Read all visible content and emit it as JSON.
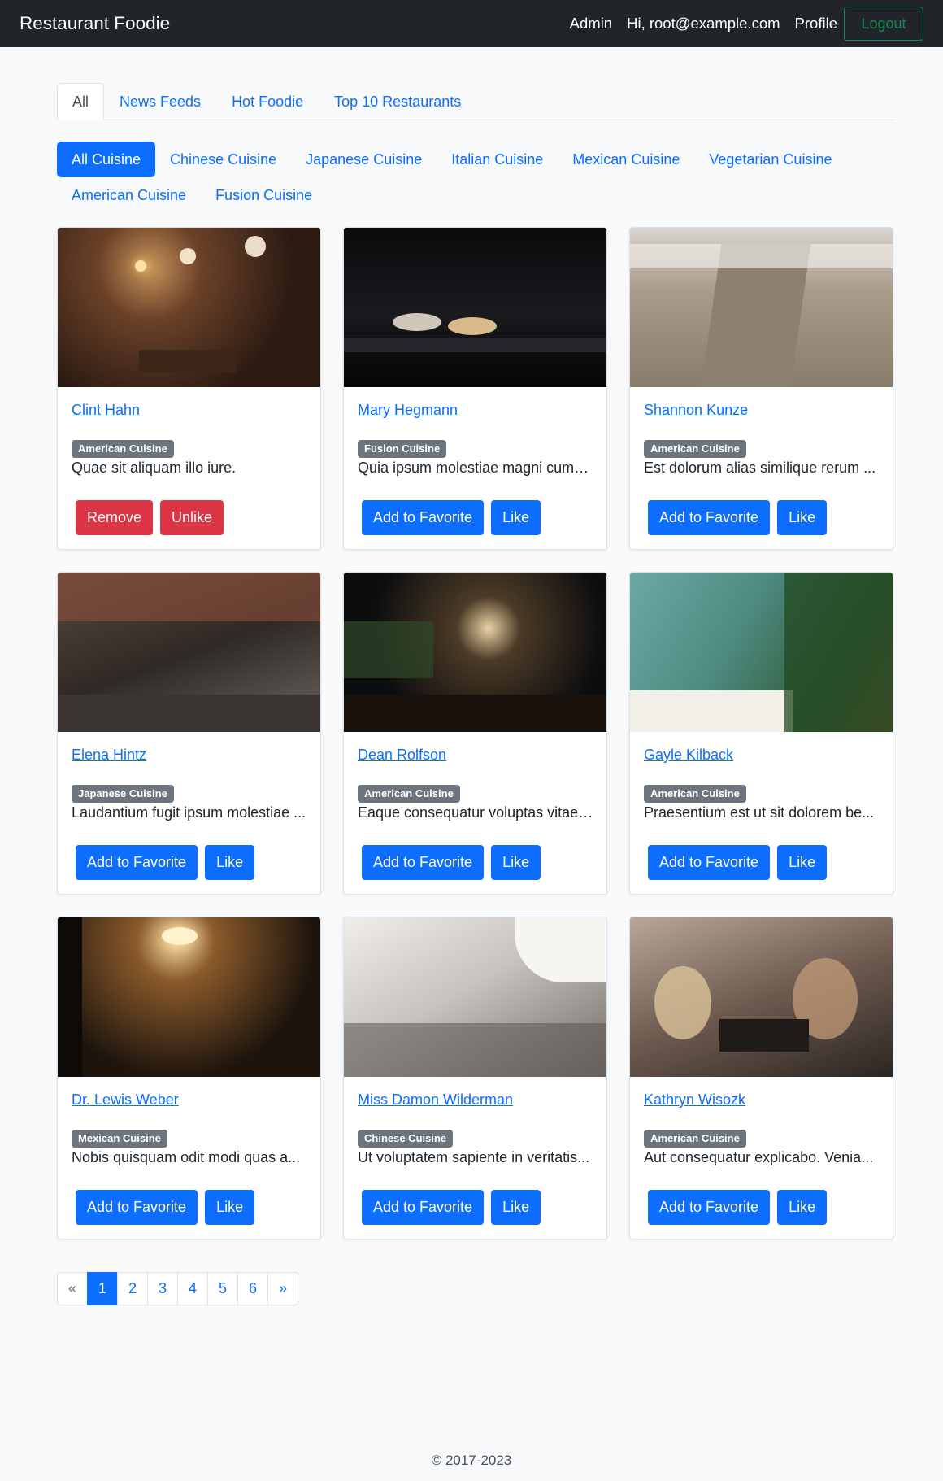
{
  "navbar": {
    "brand": "Restaurant Foodie",
    "links": [
      "Admin",
      "Hi, root@example.com",
      "Profile"
    ],
    "logout": "Logout"
  },
  "tabs": [
    {
      "label": "All",
      "active": true
    },
    {
      "label": "News Feeds",
      "active": false
    },
    {
      "label": "Hot Foodie",
      "active": false
    },
    {
      "label": "Top 10 Restaurants",
      "active": false
    }
  ],
  "cuisines": [
    {
      "label": "All Cuisine",
      "active": true
    },
    {
      "label": "Chinese Cuisine",
      "active": false
    },
    {
      "label": "Japanese Cuisine",
      "active": false
    },
    {
      "label": "Italian Cuisine",
      "active": false
    },
    {
      "label": "Mexican Cuisine",
      "active": false
    },
    {
      "label": "Vegetarian Cuisine",
      "active": false
    },
    {
      "label": "American Cuisine",
      "active": false
    },
    {
      "label": "Fusion Cuisine",
      "active": false
    }
  ],
  "restaurants": [
    {
      "name": "Clint Hahn",
      "cuisine": "American Cuisine",
      "description": "Quae sit aliquam illo iure.",
      "favorited": true,
      "liked": true
    },
    {
      "name": "Mary Hegmann",
      "cuisine": "Fusion Cuisine",
      "description": "Quia ipsum molestiae magni cumq...",
      "favorited": false,
      "liked": false
    },
    {
      "name": "Shannon Kunze",
      "cuisine": "American Cuisine",
      "description": "Est dolorum alias similique rerum ...",
      "favorited": false,
      "liked": false
    },
    {
      "name": "Elena Hintz",
      "cuisine": "Japanese Cuisine",
      "description": "Laudantium fugit ipsum molestiae ...",
      "favorited": false,
      "liked": false
    },
    {
      "name": "Dean Rolfson",
      "cuisine": "American Cuisine",
      "description": "Eaque consequatur voluptas vitae....",
      "favorited": false,
      "liked": false
    },
    {
      "name": "Gayle Kilback",
      "cuisine": "American Cuisine",
      "description": "Praesentium est ut sit dolorem be...",
      "favorited": false,
      "liked": false
    },
    {
      "name": "Dr. Lewis Weber",
      "cuisine": "Mexican Cuisine",
      "description": "Nobis quisquam odit modi quas a...",
      "favorited": false,
      "liked": false
    },
    {
      "name": "Miss Damon Wilderman",
      "cuisine": "Chinese Cuisine",
      "description": "Ut voluptatem sapiente in veritatis...",
      "favorited": false,
      "liked": false
    },
    {
      "name": "Kathryn Wisozk",
      "cuisine": "American Cuisine",
      "description": "Aut consequatur explicabo. Venia...",
      "favorited": false,
      "liked": false
    }
  ],
  "actions": {
    "add_favorite": "Add to Favorite",
    "remove_favorite": "Remove",
    "like": "Like",
    "unlike": "Unlike"
  },
  "pagination": {
    "prev": "«",
    "pages": [
      "1",
      "2",
      "3",
      "4",
      "5",
      "6"
    ],
    "current": "1",
    "next": "»"
  },
  "footer": "© 2017-2023",
  "colors": {
    "primary": "#0d6efd",
    "danger": "#dc3545",
    "success": "#198754",
    "badge": "#6c757d",
    "navbar": "#212529"
  }
}
